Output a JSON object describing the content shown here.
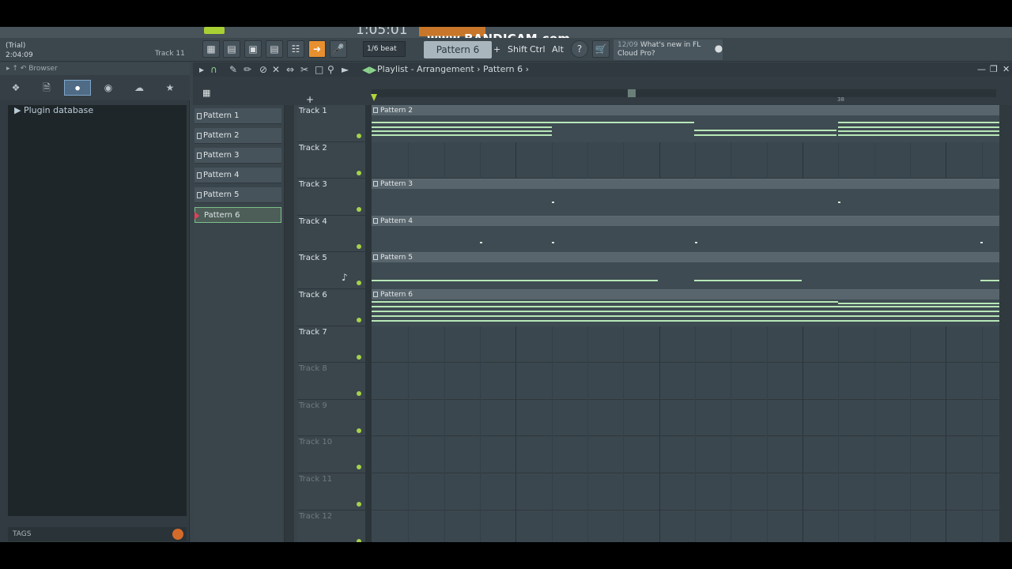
{
  "watermark": "www.BANDICAM.com",
  "transport": {
    "time": "1:05:01"
  },
  "hint_panel": {
    "line1": "(Trial)",
    "line2": "2:04:09",
    "current_track": "Track 11"
  },
  "snap": {
    "value": "1/6 beat"
  },
  "pattern_selector": {
    "value": "Pattern 6",
    "add": "+"
  },
  "keys": {
    "shift": "Shift",
    "ctrl": "Ctrl",
    "alt": "Alt"
  },
  "news": {
    "date": "12/09",
    "text": "What's new in FL Cloud Pro?"
  },
  "browser": {
    "title": "Browser",
    "tabs": [
      "all-icon",
      "file-icon",
      "plugin-icon",
      "globe-icon",
      "cloud-icon",
      "star-icon"
    ],
    "active_tab": "plugin-icon",
    "items": [
      {
        "label": "Plugin database"
      }
    ],
    "tags_label": "TAGS"
  },
  "playlist": {
    "breadcrumb": "Playlist - Arrangement › Pattern 6 ›",
    "marker": "38",
    "patterns": [
      "Pattern 1",
      "Pattern 2",
      "Pattern 3",
      "Pattern 4",
      "Pattern 5",
      "Pattern 6"
    ],
    "selected_pattern": "Pattern 6",
    "tracks": [
      "Track 1",
      "Track 2",
      "Track 3",
      "Track 4",
      "Track 5",
      "Track 6",
      "Track 7",
      "Track 8",
      "Track 9",
      "Track 10",
      "Track 11",
      "Track 12"
    ],
    "clips": [
      {
        "track": "Track 1",
        "label": "Pattern 2"
      },
      {
        "track": "Track 3",
        "label": "Pattern 3"
      },
      {
        "track": "Track 4",
        "label": "Pattern 4"
      },
      {
        "track": "Track 5",
        "label": "Pattern 5"
      },
      {
        "track": "Track 6",
        "label": "Pattern 6"
      }
    ]
  },
  "colors": {
    "accent_orange": "#e8902f",
    "note_green": "#b7e7b6",
    "led_green": "#a6d24a",
    "song_mode": "#a9d033"
  }
}
